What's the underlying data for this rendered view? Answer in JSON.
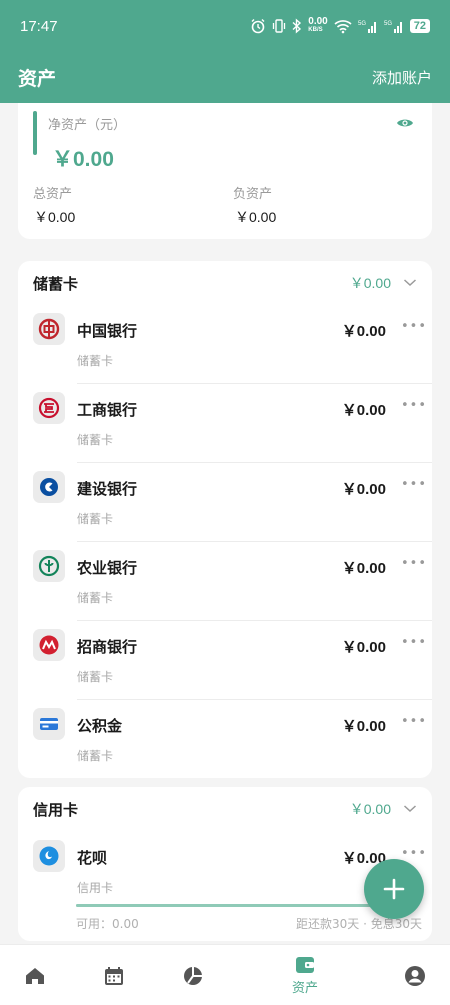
{
  "status_bar": {
    "time": "17:47",
    "net_speed": "0.00",
    "net_unit": "KB/S",
    "battery": "72"
  },
  "header": {
    "title": "资产",
    "add_account": "添加账户"
  },
  "summary": {
    "net_label": "净资产（元）",
    "net_value": "￥0.00",
    "total_assets_label": "总资产",
    "total_assets_value": "￥0.00",
    "liabilities_label": "负资产",
    "liabilities_value": "￥0.00"
  },
  "savings": {
    "title": "储蓄卡",
    "total": "￥0.00",
    "accounts": [
      {
        "name": "中国银行",
        "type": "储蓄卡",
        "amount": "￥0.00",
        "icon": "boc-logo-icon"
      },
      {
        "name": "工商银行",
        "type": "储蓄卡",
        "amount": "￥0.00",
        "icon": "icbc-logo-icon"
      },
      {
        "name": "建设银行",
        "type": "储蓄卡",
        "amount": "￥0.00",
        "icon": "ccb-logo-icon"
      },
      {
        "name": "农业银行",
        "type": "储蓄卡",
        "amount": "￥0.00",
        "icon": "abc-logo-icon"
      },
      {
        "name": "招商银行",
        "type": "储蓄卡",
        "amount": "￥0.00",
        "icon": "cmb-logo-icon"
      },
      {
        "name": "公积金",
        "type": "储蓄卡",
        "amount": "￥0.00",
        "icon": "card-icon"
      }
    ]
  },
  "credit": {
    "title": "信用卡",
    "total": "￥0.00",
    "accounts": [
      {
        "name": "花呗",
        "type": "信用卡",
        "amount": "￥0.00",
        "icon": "huabei-logo-icon",
        "available": "可用：0.00",
        "due_info": "距还款30天 · 免息30天",
        "usage_fraction": 1.0
      }
    ]
  },
  "bottom_nav": {
    "active_label": "资产",
    "items": [
      "home-icon",
      "calendar-icon",
      "pie-chart-icon",
      "wallet-icon",
      "profile-icon"
    ]
  },
  "colors": {
    "brand": "#4fa88e",
    "boc": "#c0262d",
    "icbc": "#c8102e",
    "ccb": "#0a4fa1",
    "abc": "#13845a",
    "cmb": "#d22030",
    "huabei": "#1e8fe0",
    "fund": "#2b78d8"
  }
}
